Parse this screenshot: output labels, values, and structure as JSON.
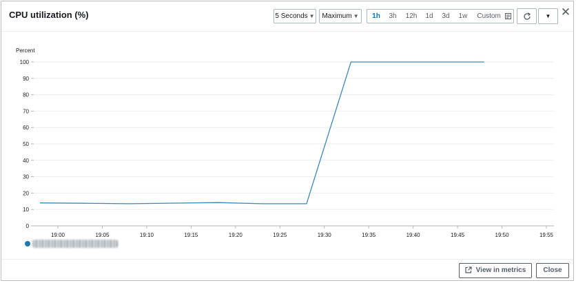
{
  "header": {
    "title": "CPU utilization (%)",
    "period_select": "5 Seconds",
    "statistic_select": "Maximum",
    "time_ranges": [
      "1h",
      "3h",
      "12h",
      "1d",
      "3d",
      "1w"
    ],
    "active_range": "1h",
    "custom_label": "Custom"
  },
  "icons": {
    "refresh": "refresh-icon",
    "dropdown": "chevron-down-icon",
    "close": "close-icon",
    "calendar": "calendar-icon",
    "external": "external-link-icon"
  },
  "footer": {
    "view_in_metrics": "View in metrics",
    "close": "Close"
  },
  "colors": {
    "series": "#1f77b4",
    "active_range": "#0073bb"
  },
  "chart_data": {
    "type": "line",
    "ylabel": "Percent",
    "ylim": [
      0,
      100
    ],
    "yticks": [
      0,
      10,
      20,
      30,
      40,
      50,
      60,
      70,
      80,
      90,
      100
    ],
    "xticks": [
      "19:00",
      "19:05",
      "19:10",
      "19:15",
      "19:20",
      "19:25",
      "19:30",
      "19:35",
      "19:40",
      "19:45",
      "19:50",
      "19:55"
    ],
    "grid": true,
    "series": [
      {
        "x": [
          "18:58",
          "19:03",
          "19:08",
          "19:18",
          "19:23",
          "19:28",
          "19:33",
          "19:38",
          "19:43",
          "19:48"
        ],
        "values": [
          14,
          13.8,
          13.5,
          14.2,
          13.5,
          13.5,
          100,
          100,
          100,
          100
        ]
      }
    ]
  }
}
